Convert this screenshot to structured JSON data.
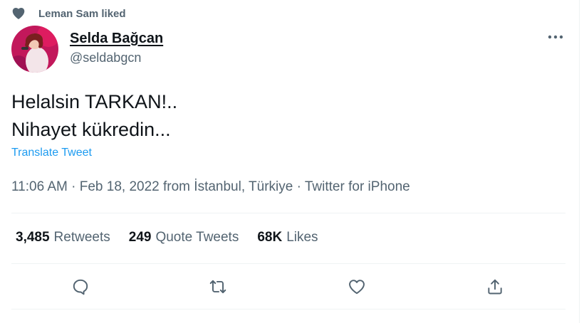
{
  "social_context": {
    "text": "Leman Sam liked",
    "icon": "heart-icon"
  },
  "author": {
    "display_name": "Selda Bağcan",
    "handle": "@seldabgcn"
  },
  "tweet": {
    "lines": [
      "Helalsin TARKAN!..",
      "Nihayet kükredin..."
    ],
    "translate_label": "Translate Tweet",
    "meta": "11:06 AM · Feb 18, 2022 from İstanbul, Türkiye · Twitter for iPhone"
  },
  "stats": [
    {
      "count": "3,485",
      "label": "Retweets"
    },
    {
      "count": "249",
      "label": "Quote Tweets"
    },
    {
      "count": "68K",
      "label": "Likes"
    }
  ],
  "actions": [
    {
      "icon": "reply-icon"
    },
    {
      "icon": "retweet-icon"
    },
    {
      "icon": "like-icon"
    },
    {
      "icon": "share-icon"
    }
  ],
  "colors": {
    "text": "#0f1419",
    "secondary": "#536471",
    "link": "#1d9bf0",
    "divider": "#eff3f4"
  }
}
